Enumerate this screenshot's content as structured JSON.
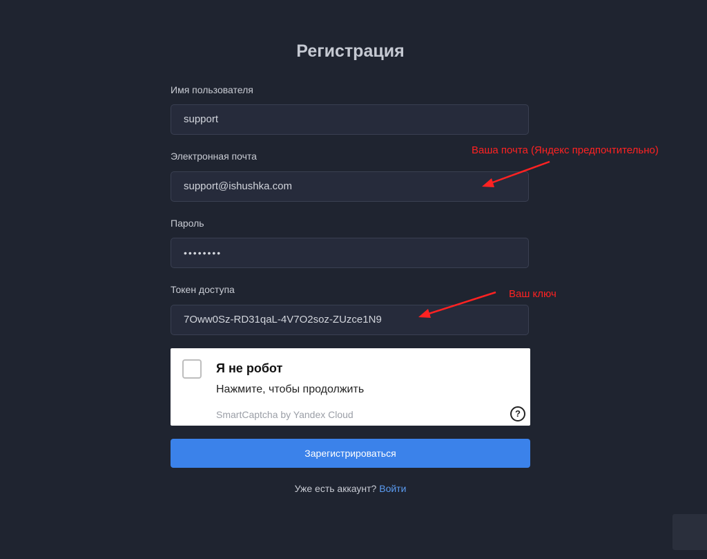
{
  "form": {
    "title": "Регистрация",
    "username": {
      "label": "Имя пользователя",
      "value": "support"
    },
    "email": {
      "label": "Электронная почта",
      "value": "support@ishushka.com"
    },
    "password": {
      "label": "Пароль",
      "value": "••••••••"
    },
    "token": {
      "label": "Токен доступа",
      "value": "7Oww0Sz-RD31qaL-4V7O2soz-ZUzce1N9"
    },
    "submit_label": "Зарегистрироваться",
    "footer": {
      "text": "Уже есть аккаунт?",
      "link": "Войти"
    }
  },
  "captcha": {
    "title": "Я не робот",
    "subtitle": "Нажмите, чтобы продолжить",
    "brand": "SmartCaptcha by Yandex Cloud",
    "help_glyph": "?"
  },
  "annotations": {
    "email_note": "Ваша почта (Яндекс предпочтительно)",
    "token_note": "Ваш ключ"
  },
  "colors": {
    "background": "#1f2430",
    "field_bg": "#262b3b",
    "accent": "#3b82ea",
    "link": "#5b9cf2",
    "annotation": "#ff2222"
  }
}
